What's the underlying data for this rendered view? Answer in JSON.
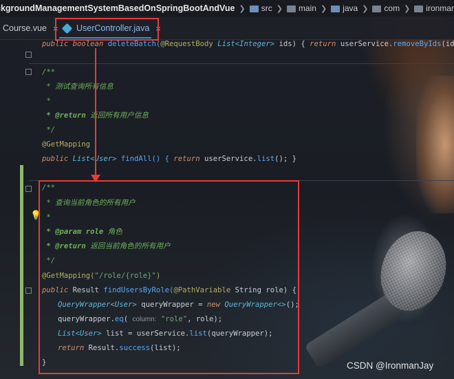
{
  "breadcrumb": {
    "project": "ckgroundManagementSystemBasedOnSpringBootAndVue",
    "items": [
      "src",
      "main",
      "java",
      "com",
      "ironmanjay"
    ]
  },
  "tabs": [
    {
      "label": "Course.vue"
    },
    {
      "label": "UserController.java",
      "active": true
    }
  ],
  "code": {
    "deleteBatch": {
      "kw1": "public",
      "kw2": "boolean",
      "name": "deleteBatch(",
      "annot": "@RequestBody",
      "type": "List<Integer>",
      "param": " ids) { ",
      "ret": "return",
      "call": " userService.",
      "method": "removeByIds",
      "tail": "(ids); }"
    },
    "findAll_doc": {
      "open": "/**",
      "desc": " * 测试查询所有信息",
      "star": " *",
      "return_tag": " * @return",
      "return_desc": " 返回所有用户信息",
      "close": " */"
    },
    "findAll": {
      "annotation": "@GetMapping",
      "kw": "public",
      "type": "List<User>",
      "name": " findAll() { ",
      "ret": "return",
      "call": " userService.",
      "method": "list",
      "tail": "(); }"
    },
    "findByRole_doc": {
      "open": "/**",
      "desc": " * 查询当前角色的所有用户",
      "star": " *",
      "param_tag": " * @param",
      "param_name": " role",
      "param_desc": " 角色",
      "return_tag": " * @return",
      "return_desc": " 返回当前角色的所有用户",
      "close": " */"
    },
    "findByRole": {
      "annotation": "@GetMapping(",
      "path": "\"/role/{role}\"",
      "annotation_close": ")",
      "sig_kw": "public",
      "sig_type": " Result ",
      "sig_name": "findUsersByRole(",
      "sig_annot": "@PathVariable",
      "sig_param": " String role) {",
      "l1_type": "QueryWrapper<User>",
      "l1_var": " queryWrapper = ",
      "l1_new": "new",
      "l1_ctor": " QueryWrapper<>",
      "l1_tail": "();",
      "l2_var": "queryWrapper.",
      "l2_method": "eq",
      "l2_open": "( ",
      "l2_hint": "column:",
      "l2_str": " \"role\"",
      "l2_tail": ", role);",
      "l3_type": "List<User>",
      "l3_var": " list = userService.",
      "l3_method": "list",
      "l3_tail": "(queryWrapper);",
      "l4_ret": "return",
      "l4_cls": " Result.",
      "l4_method": "success",
      "l4_tail": "(list);",
      "close": "}"
    }
  },
  "watermark": "CSDN @IronmanJay"
}
